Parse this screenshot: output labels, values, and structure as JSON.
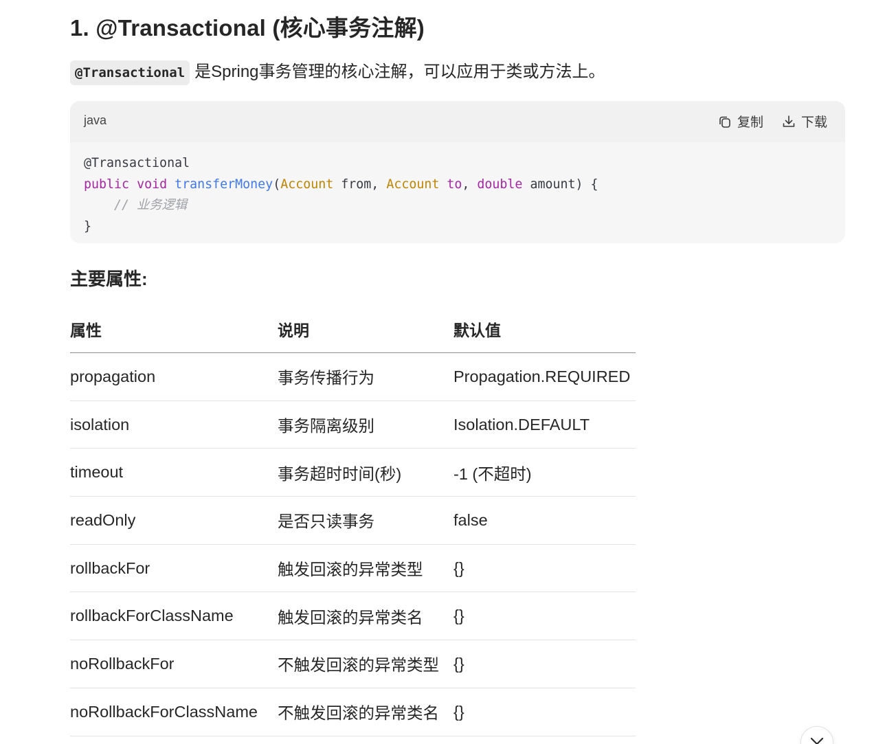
{
  "heading": {
    "title": "1. @Transactional (核心事务注解)"
  },
  "intro": {
    "code": "@Transactional",
    "text": "是Spring事务管理的核心注解，可以应用于类或方法上。"
  },
  "code_block": {
    "language": "java",
    "copy_label": "复制",
    "download_label": "下载",
    "icons": [
      "copy-icon",
      "download-icon"
    ],
    "lines": {
      "annotation": "@Transactional",
      "kw_public": "public",
      "kw_void": "void",
      "method": "transferMoney",
      "paren_open": "(",
      "type1": "Account",
      "param1": " from, ",
      "type2": "Account",
      "param2_kw": "to",
      "comma": ", ",
      "kw_double": "double",
      "param3": " amount) {",
      "comment": "// 业务逻辑",
      "close": "}"
    },
    "colors": {
      "keyword": "#a626a4",
      "function": "#4078f2",
      "type": "#c18401",
      "comment": "#a0a1a7"
    }
  },
  "subtitle": "主要属性:",
  "table": {
    "headers": [
      "属性",
      "说明",
      "默认值"
    ],
    "rows": [
      [
        "propagation",
        "事务传播行为",
        "Propagation.REQUIRED"
      ],
      [
        "isolation",
        "事务隔离级别",
        "Isolation.DEFAULT"
      ],
      [
        "timeout",
        "事务超时时间(秒)",
        "-1 (不超时)"
      ],
      [
        "readOnly",
        "是否只读事务",
        "false"
      ],
      [
        "rollbackFor",
        "触发回滚的异常类型",
        "{}"
      ],
      [
        "rollbackForClassName",
        "触发回滚的异常类名",
        "{}"
      ],
      [
        "noRollbackFor",
        "不触发回滚的异常类型",
        "{}"
      ],
      [
        "noRollbackForClassName",
        "不触发回滚的异常类名",
        "{}"
      ]
    ]
  },
  "scroll_button": {
    "icon": "chevron-down-icon"
  }
}
